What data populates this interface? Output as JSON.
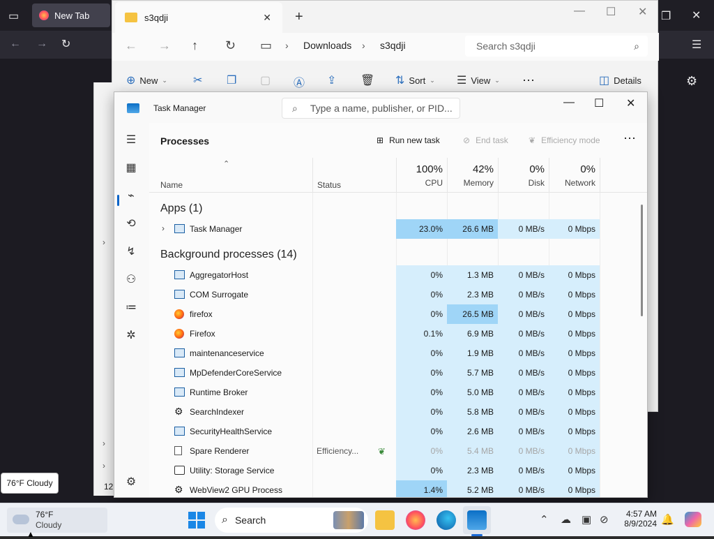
{
  "browser": {
    "tab_label": "New Tab"
  },
  "explorer": {
    "tab_title": "s3qdji",
    "breadcrumb": [
      "Downloads",
      "s3qdji"
    ],
    "search_placeholder": "Search s3qdji",
    "commands": {
      "new": "New",
      "sort": "Sort",
      "view": "View",
      "details": "Details"
    },
    "side_number": "12"
  },
  "task_manager": {
    "title": "Task Manager",
    "search_placeholder": "Type a name, publisher, or PID...",
    "page_title": "Processes",
    "actions": {
      "run_new_task": "Run new task",
      "end_task": "End task",
      "efficiency_mode": "Efficiency mode"
    },
    "columns": {
      "name": "Name",
      "status": "Status",
      "cpu": {
        "pct": "100%",
        "label": "CPU"
      },
      "memory": {
        "pct": "42%",
        "label": "Memory"
      },
      "disk": {
        "pct": "0%",
        "label": "Disk"
      },
      "network": {
        "pct": "0%",
        "label": "Network"
      }
    },
    "apps_header": "Apps (1)",
    "apps": [
      {
        "name": "Task Manager",
        "cpu": "23.0%",
        "memory": "26.6 MB",
        "disk": "0 MB/s",
        "network": "0 Mbps"
      }
    ],
    "bg_header": "Background processes (14)",
    "background": [
      {
        "name": "AggregatorHost",
        "cpu": "0%",
        "memory": "1.3 MB",
        "disk": "0 MB/s",
        "network": "0 Mbps"
      },
      {
        "name": "COM Surrogate",
        "cpu": "0%",
        "memory": "2.3 MB",
        "disk": "0 MB/s",
        "network": "0 Mbps"
      },
      {
        "name": "firefox",
        "cpu": "0%",
        "memory": "26.5 MB",
        "disk": "0 MB/s",
        "network": "0 Mbps"
      },
      {
        "name": "Firefox",
        "cpu": "0.1%",
        "memory": "6.9 MB",
        "disk": "0 MB/s",
        "network": "0 Mbps"
      },
      {
        "name": "maintenanceservice",
        "cpu": "0%",
        "memory": "1.9 MB",
        "disk": "0 MB/s",
        "network": "0 Mbps"
      },
      {
        "name": "MpDefenderCoreService",
        "cpu": "0%",
        "memory": "5.7 MB",
        "disk": "0 MB/s",
        "network": "0 Mbps"
      },
      {
        "name": "Runtime Broker",
        "cpu": "0%",
        "memory": "5.0 MB",
        "disk": "0 MB/s",
        "network": "0 Mbps"
      },
      {
        "name": "SearchIndexer",
        "cpu": "0%",
        "memory": "5.8 MB",
        "disk": "0 MB/s",
        "network": "0 Mbps"
      },
      {
        "name": "SecurityHealthService",
        "cpu": "0%",
        "memory": "2.6 MB",
        "disk": "0 MB/s",
        "network": "0 Mbps"
      },
      {
        "name": "Spare Renderer",
        "status": "Efficiency...",
        "cpu": "0%",
        "memory": "5.4 MB",
        "disk": "0 MB/s",
        "network": "0 Mbps"
      },
      {
        "name": "Utility: Storage Service",
        "cpu": "0%",
        "memory": "2.3 MB",
        "disk": "0 MB/s",
        "network": "0 Mbps"
      },
      {
        "name": "WebView2 GPU Process",
        "cpu": "1.4%",
        "memory": "5.2 MB",
        "disk": "0 MB/s",
        "network": "0 Mbps"
      }
    ]
  },
  "weather": {
    "temp": "76°F",
    "desc": "Cloudy",
    "tooltip": "76°F Cloudy"
  },
  "taskbar": {
    "search_label": "Search",
    "time": "4:57 AM",
    "date": "8/9/2024"
  }
}
